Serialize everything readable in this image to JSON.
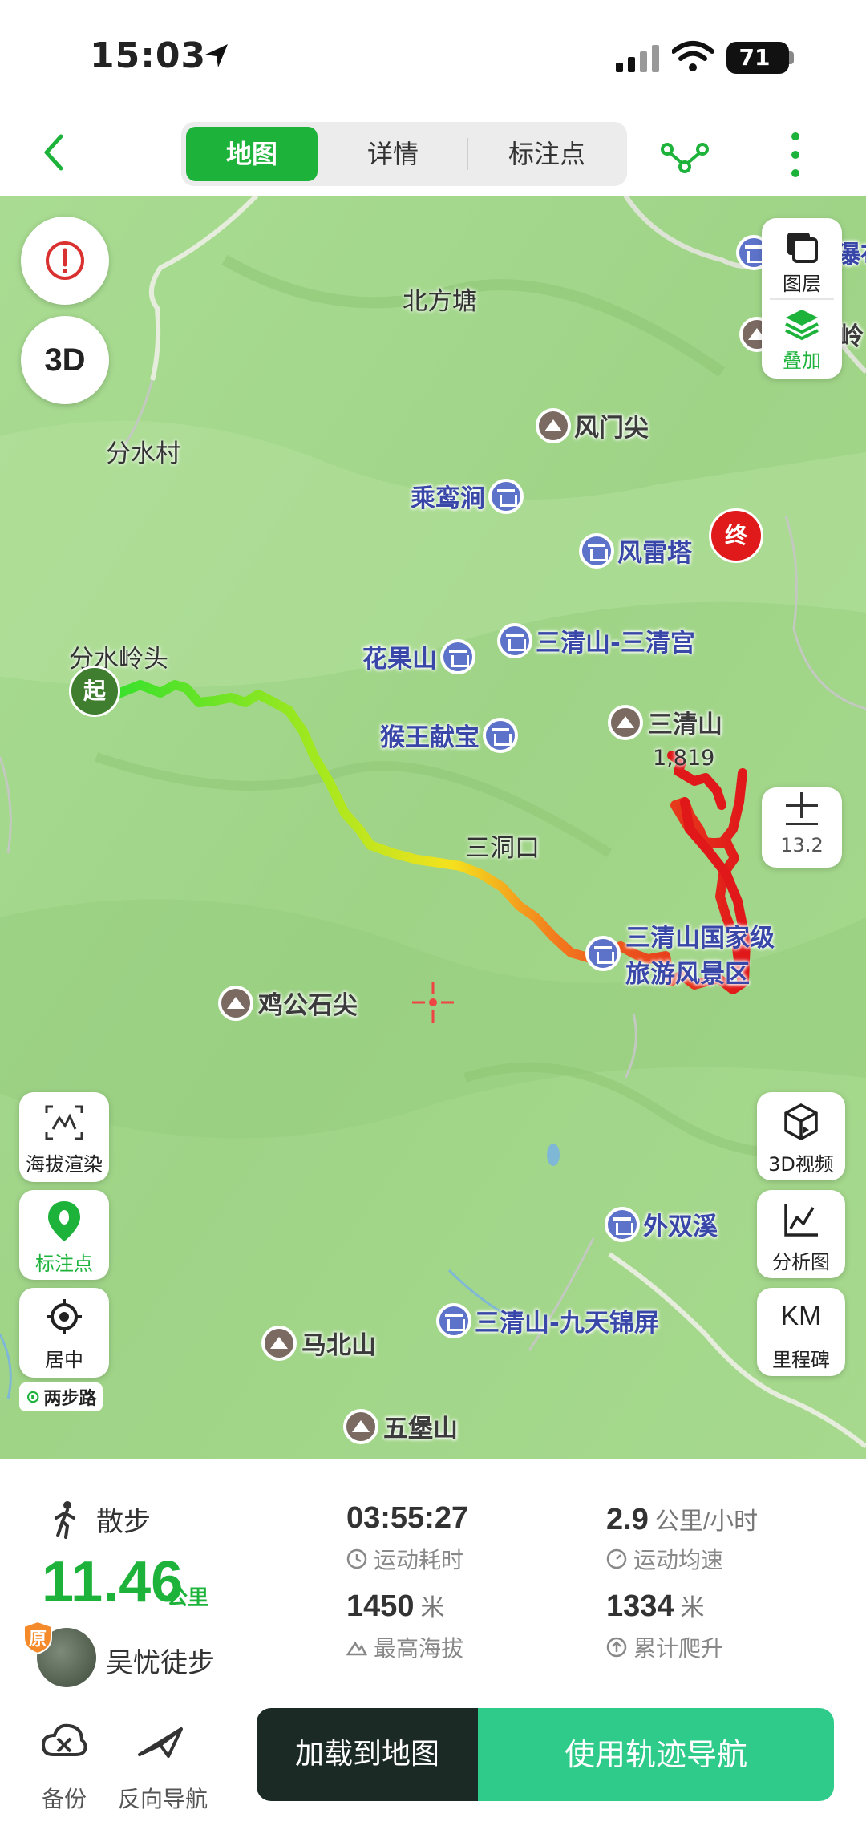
{
  "status_bar": {
    "time": "15:03",
    "battery": "71"
  },
  "nav": {
    "tabs": [
      {
        "label": "地图",
        "active": true
      },
      {
        "label": "详情",
        "active": false
      },
      {
        "label": "标注点",
        "active": false
      }
    ]
  },
  "map": {
    "places": {
      "beifangtang": "北方塘",
      "fenshuicun": "分水村",
      "fenshuilingtou": "分水岭头",
      "sandongkou": "三洞口"
    },
    "pois": {
      "fengmenjian": "风门尖",
      "chengluanjian": "乘鸾涧",
      "fengleita": "风雷塔",
      "huaguoshan": "花果山",
      "sanqinggong": "三清山-三清宫",
      "houwangxianbao": "猴王献宝",
      "sanqingshan": "三清山",
      "sanqingshan_elev": "1,819",
      "scenic_area_line1": "三清山国家级",
      "scenic_area_line2": "旅游风景区",
      "jigongshijian": "鸡公石尖",
      "waishuangxi": "外双溪",
      "jiutianjinping": "三清山-九天锦屏",
      "mabeishan": "马北山",
      "wubaoshan": "五堡山",
      "edge_top_right_1": "瀑布",
      "edge_top_right_2": "岭"
    },
    "markers": {
      "start": "起",
      "end": "终"
    },
    "controls": {
      "layers": "图层",
      "overlay": "叠加",
      "zoom_level": "13.2",
      "elevation_render": "海拔渲染",
      "annotation": "标注点",
      "center": "居中",
      "video_3d": "3D视频",
      "analysis": "分析图",
      "km_title": "KM",
      "milestone": "里程碑",
      "three_d": "3D",
      "brand": "两步路"
    },
    "colors": {
      "route_start": "#2ee02e",
      "route_mid": "#f5e11e",
      "route_end": "#e0181a",
      "accent": "#1db33b"
    }
  },
  "summary": {
    "activity_type": "散步",
    "distance_value": "11.46",
    "distance_unit": "公里",
    "duration_value": "03:55:27",
    "duration_label": "运动耗时",
    "speed_value": "2.9",
    "speed_unit": "公里/小时",
    "speed_label": "运动均速",
    "max_elev_value": "1450",
    "max_elev_unit": "米",
    "max_elev_label": "最高海拔",
    "ascent_value": "1334",
    "ascent_unit": "米",
    "ascent_label": "累计爬升",
    "author_badge": "原",
    "author_name": "吴忧徒步"
  },
  "actions": {
    "backup": "备份",
    "reverse_nav": "反向导航",
    "load_to_map": "加载到地图",
    "use_track_nav": "使用轨迹导航"
  }
}
